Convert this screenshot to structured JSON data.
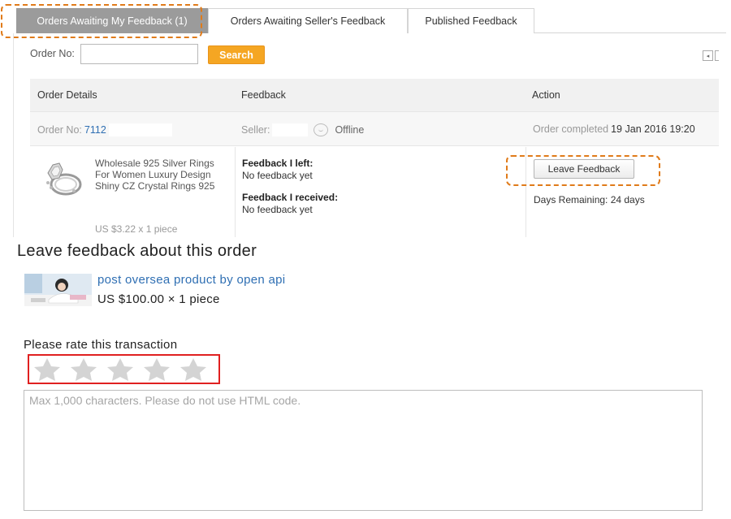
{
  "tabs": [
    {
      "label": "Orders Awaiting My Feedback (1)",
      "active": true
    },
    {
      "label": "Orders Awaiting Seller's Feedback",
      "active": false
    },
    {
      "label": "Published Feedback",
      "active": false
    }
  ],
  "search": {
    "label": "Order No:",
    "value": "",
    "button_label": "Search"
  },
  "pager": {
    "prev_icon": "◂"
  },
  "table": {
    "headers": [
      "Order Details",
      "Feedback",
      "Action"
    ],
    "order_row": {
      "order_label": "Order No:",
      "order_no_partial": "7112",
      "seller_label": "Seller:",
      "seller_status": "Offline",
      "status_prefix": "Order completed",
      "status_date": "19 Jan 2016 19:20"
    },
    "detail": {
      "product_title": "Wholesale 925 Silver Rings For Women Luxury Design Shiny CZ Crystal Rings 925",
      "product_price": "US $3.22 x 1 piece",
      "feedback_left_label": "Feedback I left:",
      "feedback_left_value": "No feedback yet",
      "feedback_received_label": "Feedback I received:",
      "feedback_received_value": "No feedback yet",
      "leave_button_label": "Leave Feedback",
      "days_remaining": "Days Remaining: 24 days"
    }
  },
  "leave_feedback": {
    "title": "Leave feedback about this order",
    "product_link": "post oversea product by open api",
    "product_price": "US $100.00 × 1 piece",
    "rate_label": "Please rate this transaction",
    "rating": 0,
    "max_rating": 5,
    "textarea_placeholder": "Max 1,000 characters. Please do not use HTML code."
  },
  "colors": {
    "accent_orange": "#f5a623",
    "highlight_dashed": "#e07b1a",
    "highlight_red": "#e02020",
    "link_blue": "#2f6fb3",
    "star_empty": "#d4d4d4"
  }
}
